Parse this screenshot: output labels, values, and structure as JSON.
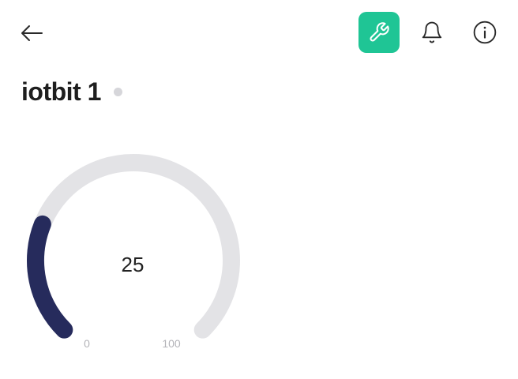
{
  "header": {
    "back_icon": "arrow-left-icon",
    "actions": [
      {
        "name": "wrench-icon",
        "active": true
      },
      {
        "name": "bell-icon",
        "active": false
      },
      {
        "name": "info-icon",
        "active": false
      }
    ]
  },
  "device": {
    "name": "iotbit 1",
    "status": "offline"
  },
  "gauge": {
    "value": 25,
    "value_label": "25",
    "min": 0,
    "max": 100,
    "min_label": "0",
    "max_label": "100",
    "fill_color": "#262b5c",
    "track_color": "#e3e3e6"
  },
  "colors": {
    "accent": "#1fc595",
    "status_offline": "#d6d6da"
  }
}
